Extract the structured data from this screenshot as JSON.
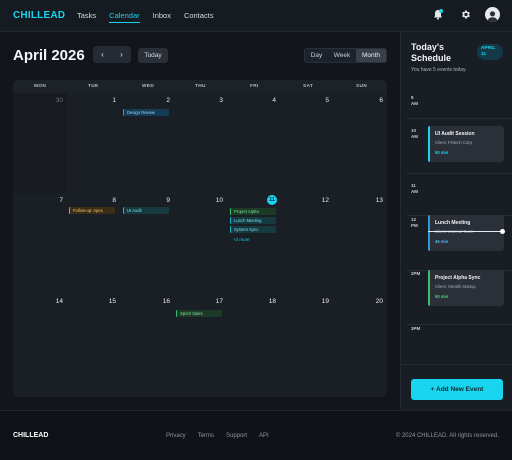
{
  "brand": {
    "name_part1": "CHILL",
    "name_part2": "EAD",
    "accent": "#19d4ee"
  },
  "nav": {
    "links": [
      {
        "label": "Tasks"
      },
      {
        "label": "Calendar",
        "active": true
      },
      {
        "label": "Inbox"
      },
      {
        "label": "Contacts"
      }
    ],
    "icons": [
      "bell-icon",
      "gear-icon",
      "avatar"
    ]
  },
  "calendar": {
    "title": "April 2026",
    "prev": "‹",
    "next": "›",
    "today_label": "Today",
    "views": [
      "Day",
      "Week",
      "Month"
    ],
    "active_view": "Month",
    "weekdays": [
      "MON",
      "TUE",
      "WED",
      "THU",
      "FRI",
      "SAT",
      "SUN"
    ],
    "weeks": [
      [
        "30",
        "1",
        "2",
        "3",
        "4",
        "5",
        "6"
      ],
      [
        "7",
        "8",
        "9",
        "10",
        "11",
        "12",
        "13"
      ],
      [
        "14",
        "15",
        "16",
        "17",
        "18",
        "19",
        "20"
      ]
    ],
    "today_day": "11",
    "events": {
      "design_review": "Design Review",
      "followup": "Follow-up: Apex",
      "ui_audit": "UI Audit",
      "project_alpha": "Project Alpha",
      "lunch": "Lunch Meeting",
      "system_sync": "System Sync",
      "more": "+2 more",
      "sprint": "Sprint Sales"
    }
  },
  "schedule": {
    "title": "Today's Schedule",
    "date_badge": "APRIL 11",
    "date_badge_line1": "APRIL",
    "date_badge_line2": "11",
    "subtitle": "You have 5 events today.",
    "hours": [
      {
        "label": "9",
        "suffix": "AM"
      },
      {
        "label": "10",
        "suffix": "AM"
      },
      {
        "label": "11",
        "suffix": "AM"
      },
      {
        "label": "12",
        "suffix": "PM"
      },
      {
        "label": "1PM",
        "suffix": ""
      },
      {
        "label": "2PM",
        "suffix": ""
      },
      {
        "label": "3PM",
        "suffix": ""
      },
      {
        "label": "4PM",
        "suffix": ""
      }
    ],
    "cards": [
      {
        "title": "UI Audit Session",
        "client": "Client: Fintech Corp",
        "duration": "90 min",
        "color": "#19d4ee"
      },
      {
        "title": "Lunch Meeting",
        "client": "Client: Internal Team",
        "duration": "45 min",
        "color": "#2e9bd8"
      },
      {
        "title": "Project Alpha Sync",
        "client": "Client: Stealth Startup",
        "duration": "90 min",
        "color": "#3bbf6a"
      }
    ],
    "add_button": "+ Add New Event"
  },
  "footer": {
    "logo": "CHILLEAD",
    "links": [
      "Privacy",
      "Terms",
      "Support",
      "API"
    ],
    "copyright": "© 2024 CHILLEAD. All rights reserved."
  }
}
